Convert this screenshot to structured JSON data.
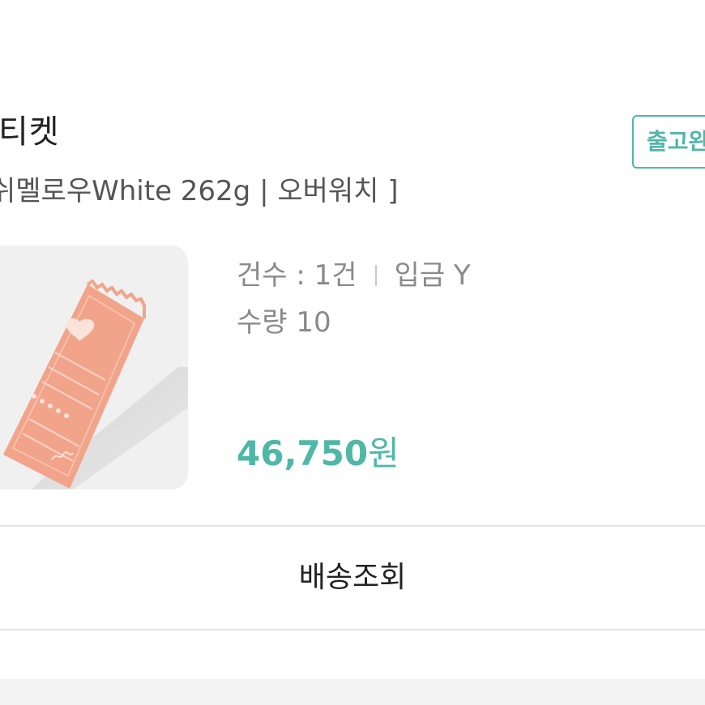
{
  "order": {
    "product_title": "티켓",
    "option_text": "쉬멜로우White 262g | 오버워치 ]",
    "status_badge": "출고완",
    "count_text": "건수 : 1건",
    "deposit_text": "입금 Y",
    "quantity_text": "수량 10",
    "price_value": "46,750",
    "price_unit": "원"
  },
  "actions": {
    "track_delivery_label": "배송조회"
  },
  "colors": {
    "accent": "#4fb7a6",
    "thumbnail_bg": "#f0f0f0",
    "ticket": "#f2a48b"
  },
  "image": {
    "thumbnail": "peach-ticket-product-photo"
  }
}
